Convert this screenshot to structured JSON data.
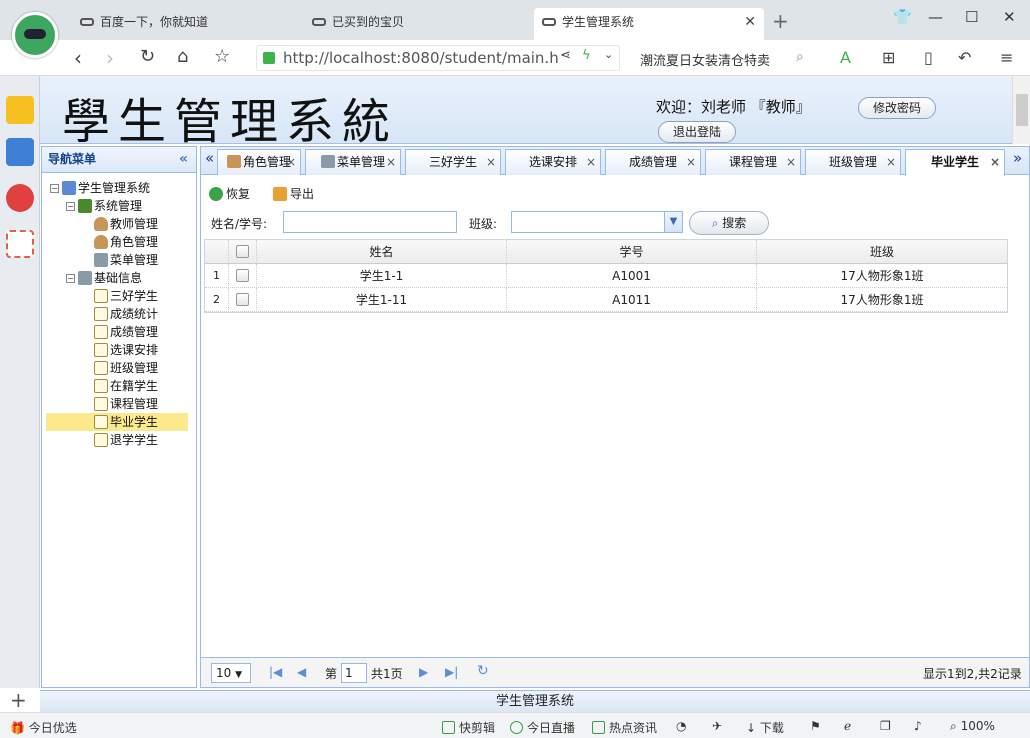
{
  "browser": {
    "tabs": [
      {
        "label": "百度一下，你就知道"
      },
      {
        "label": "已买到的宝贝"
      },
      {
        "label": "学生管理系统"
      }
    ],
    "new_tab": "+",
    "url": "http://localhost:8080/student/main.h",
    "promo": "潮流夏日女装清仓特卖",
    "zoom": "100%"
  },
  "header": {
    "title": "學生管理系統",
    "welcome": "欢迎：刘老师 『教师』",
    "change_password": "修改密码",
    "logout": "退出登陆"
  },
  "nav": {
    "title": "导航菜单",
    "collapse": "«",
    "tree": [
      {
        "label": "学生管理系统",
        "level": 0,
        "icon": "home-icon"
      },
      {
        "label": "系统管理",
        "level": 1,
        "icon": "folder-icon"
      },
      {
        "label": "教师管理",
        "level": 2,
        "icon": "user-icon"
      },
      {
        "label": "角色管理",
        "level": 2,
        "icon": "user-icon"
      },
      {
        "label": "菜单管理",
        "level": 2,
        "icon": "menu-icon"
      },
      {
        "label": "基础信息",
        "level": 1,
        "icon": "key-icon"
      },
      {
        "label": "三好学生",
        "level": 2,
        "icon": "file-icon"
      },
      {
        "label": "成绩统计",
        "level": 2,
        "icon": "file-icon"
      },
      {
        "label": "成绩管理",
        "level": 2,
        "icon": "file-icon"
      },
      {
        "label": "选课安排",
        "level": 2,
        "icon": "file-icon"
      },
      {
        "label": "班级管理",
        "level": 2,
        "icon": "file-icon"
      },
      {
        "label": "在籍学生",
        "level": 2,
        "icon": "file-icon"
      },
      {
        "label": "课程管理",
        "level": 2,
        "icon": "file-icon"
      },
      {
        "label": "毕业学生",
        "level": 2,
        "icon": "file-icon",
        "selected": true
      },
      {
        "label": "退学学生",
        "level": 2,
        "icon": "file-icon"
      }
    ]
  },
  "tabs": [
    {
      "label": "角色管理"
    },
    {
      "label": "菜单管理"
    },
    {
      "label": "三好学生"
    },
    {
      "label": "选课安排"
    },
    {
      "label": "成绩管理"
    },
    {
      "label": "课程管理"
    },
    {
      "label": "班级管理"
    },
    {
      "label": "毕业学生",
      "active": true
    }
  ],
  "tab_close": "×",
  "toolbar": {
    "restore": "恢复",
    "export": "导出"
  },
  "filter": {
    "name_label": "姓名/学号:",
    "class_label": "班级:",
    "search": "搜索"
  },
  "grid": {
    "columns": [
      "姓名",
      "学号",
      "班级"
    ],
    "rows": [
      {
        "num": "1",
        "name": "学生1-1",
        "id": "A1001",
        "class": "17人物形象1班"
      },
      {
        "num": "2",
        "name": "学生1-11",
        "id": "A1011",
        "class": "17人物形象1班"
      }
    ]
  },
  "pager": {
    "page_size": "10",
    "page_label": "第",
    "page": "1",
    "total_pages": "共1页",
    "summary": "显示1到2,共2记录"
  },
  "footer": "学生管理系统",
  "statusbar": {
    "left": "今日优选",
    "items": [
      "快剪辑",
      "今日直播",
      "热点资讯",
      "下载"
    ]
  },
  "colors": {
    "panel_border": "#99bbe8",
    "selected_row": "#fbe98b"
  }
}
